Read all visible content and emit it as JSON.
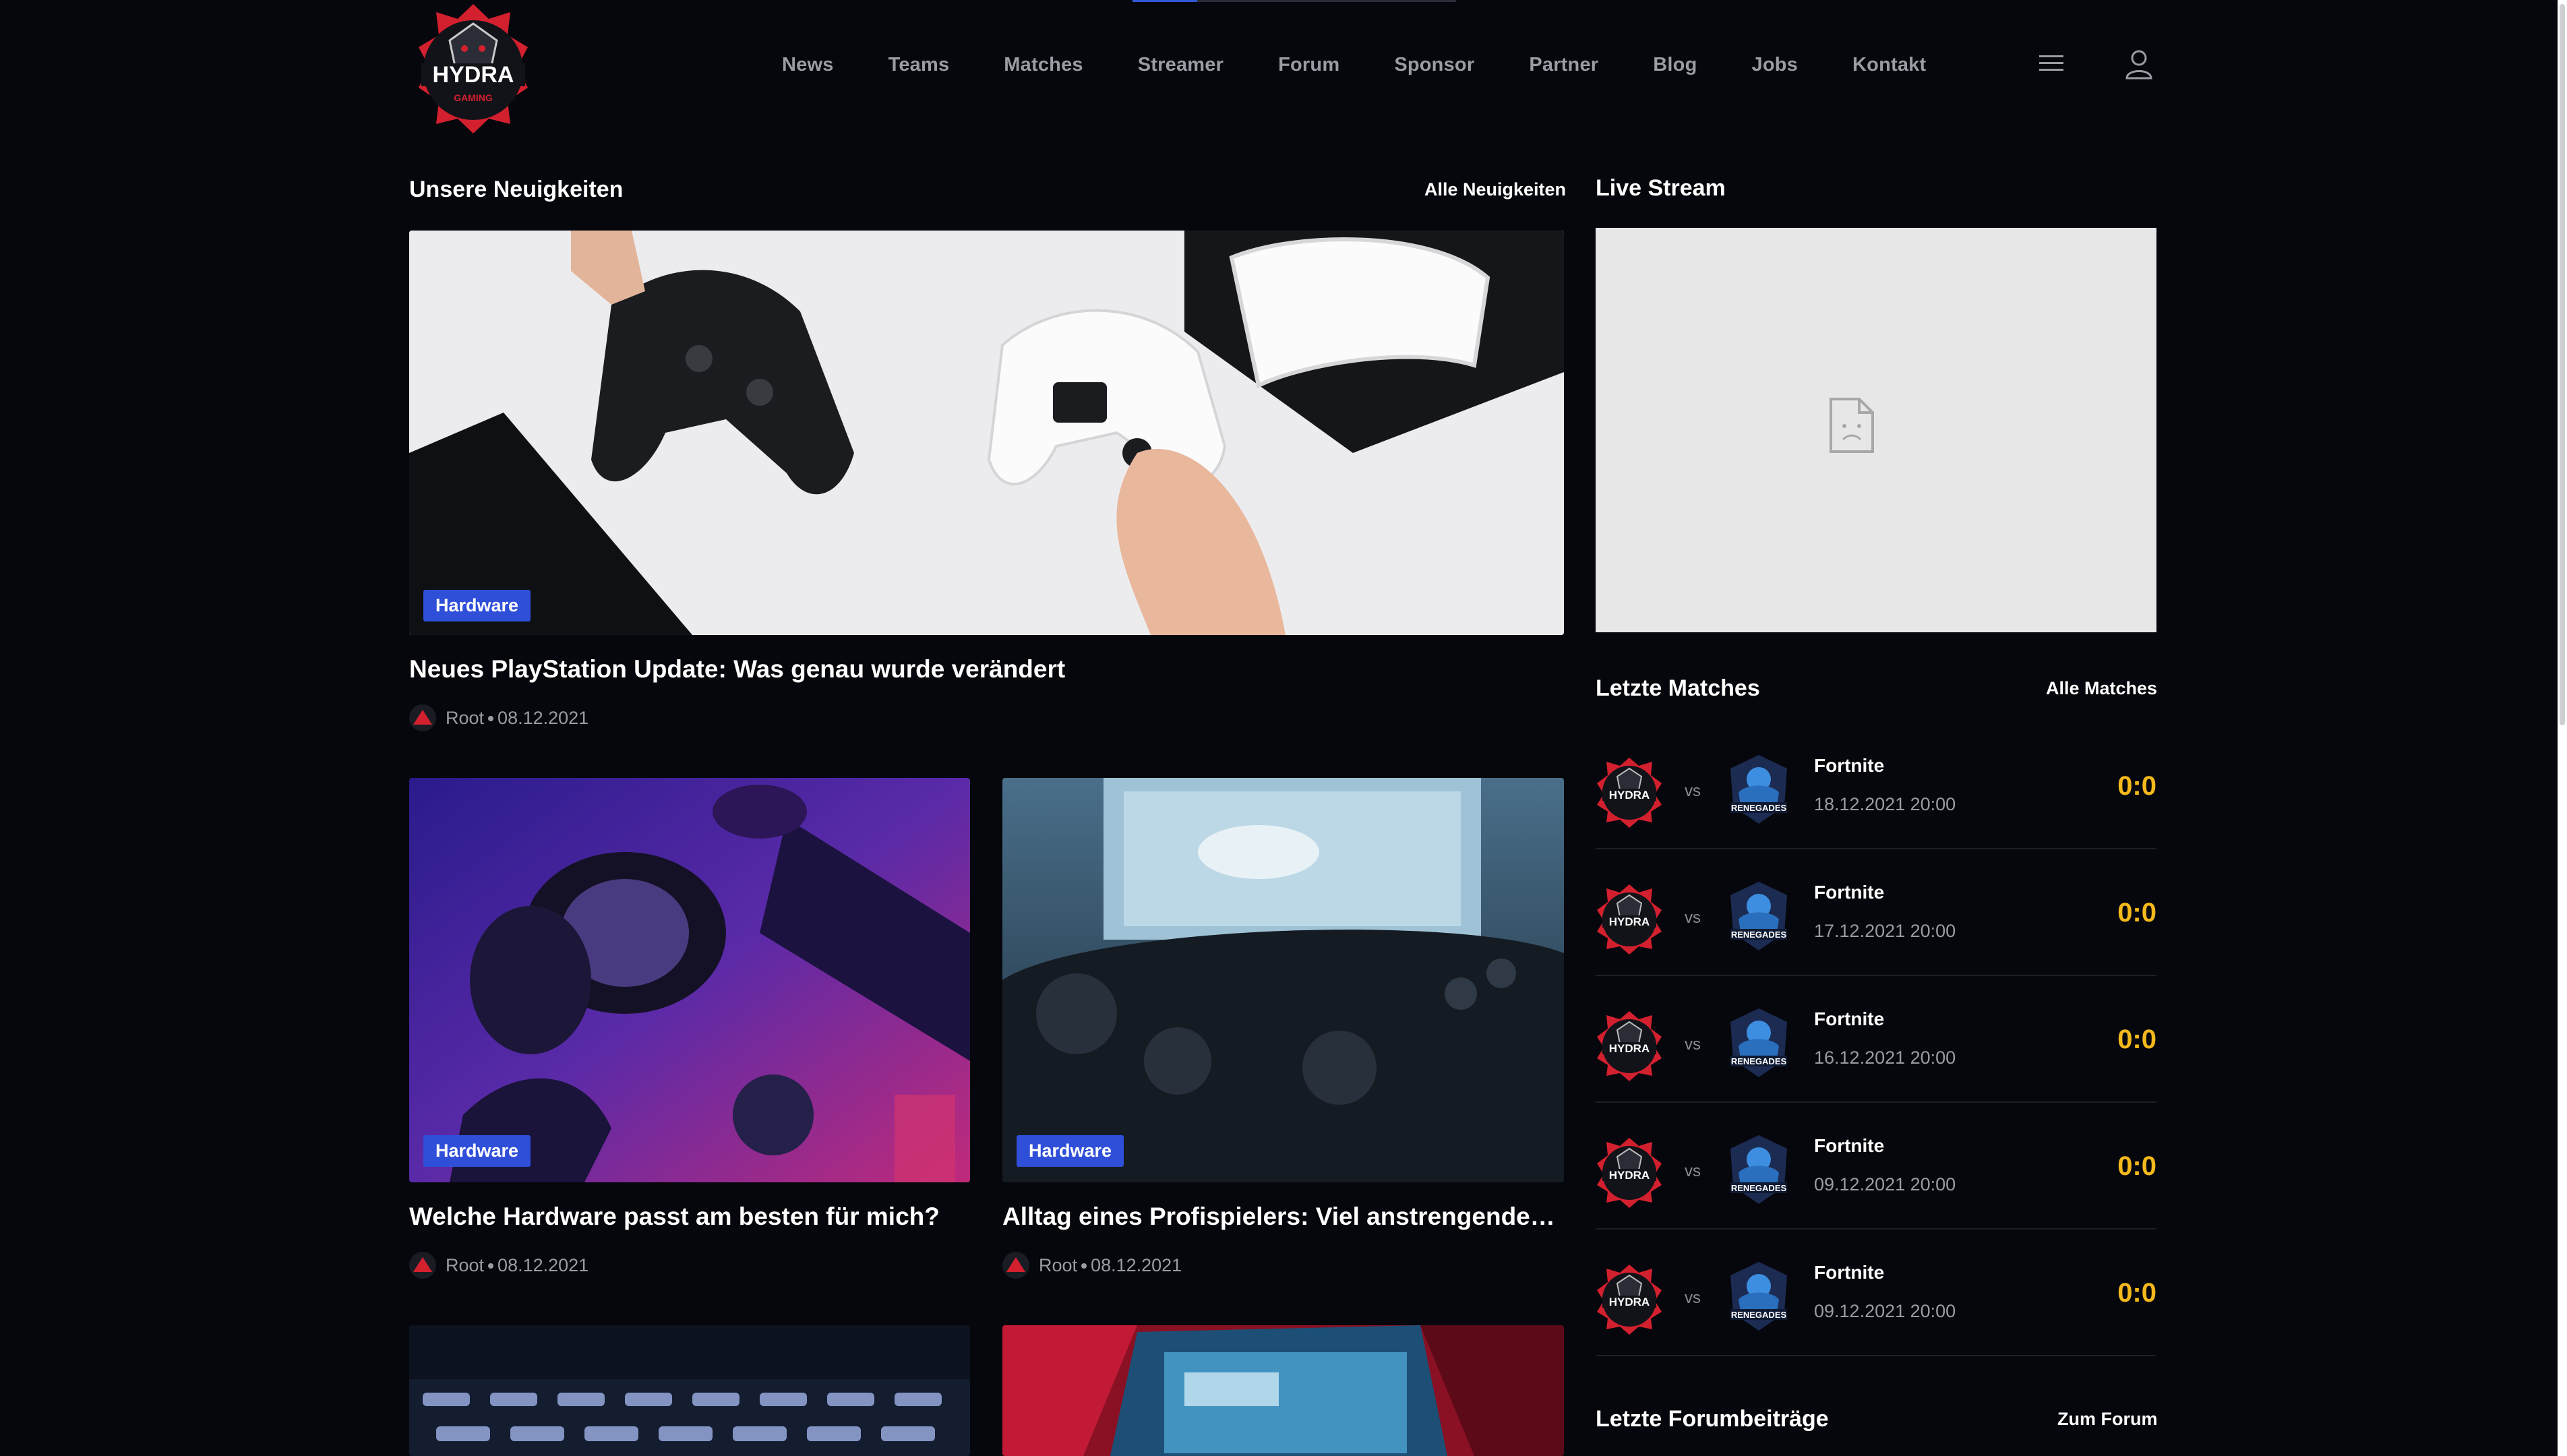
{
  "header": {
    "nav": [
      "News",
      "Teams",
      "Matches",
      "Streamer",
      "Forum",
      "Sponsor",
      "Partner",
      "Blog",
      "Jobs",
      "Kontakt"
    ],
    "menu_icon": "hamburger-icon",
    "user_icon": "user-icon",
    "logo_text": "HYDRA",
    "logo_sub": "GAMING"
  },
  "news": {
    "title": "Unsere Neuigkeiten",
    "all_link": "Alle Neuigkeiten",
    "articles": [
      {
        "badge": "Hardware",
        "title": "Neues PlayStation Update: Was genau wurde verändert",
        "author": "Root",
        "date": "08.12.2021"
      },
      {
        "badge": "Hardware",
        "title": "Welche Hardware passt am besten für mich?",
        "author": "Root",
        "date": "08.12.2021"
      },
      {
        "badge": "Hardware",
        "title": "Alltag eines Profispielers: Viel anstrengender al...",
        "author": "Root",
        "date": "08.12.2021"
      }
    ]
  },
  "live": {
    "title": "Live Stream",
    "placeholder_icon": "broken-file-icon"
  },
  "matches": {
    "title": "Letzte Matches",
    "all_link": "Alle Matches",
    "vs": "vs",
    "rows": [
      {
        "game": "Fortnite",
        "date": "18.12.2021 20:00",
        "score": "0:0"
      },
      {
        "game": "Fortnite",
        "date": "17.12.2021 20:00",
        "score": "0:0"
      },
      {
        "game": "Fortnite",
        "date": "16.12.2021 20:00",
        "score": "0:0"
      },
      {
        "game": "Fortnite",
        "date": "09.12.2021 20:00",
        "score": "0:0"
      },
      {
        "game": "Fortnite",
        "date": "09.12.2021 20:00",
        "score": "0:0"
      }
    ]
  },
  "forum": {
    "title": "Letzte Forumbeiträge",
    "link": "Zum Forum"
  },
  "colors": {
    "background": "#06070c",
    "badge": "#2f4fd8",
    "score": "#f5b91c",
    "logo_red": "#d3202f"
  }
}
